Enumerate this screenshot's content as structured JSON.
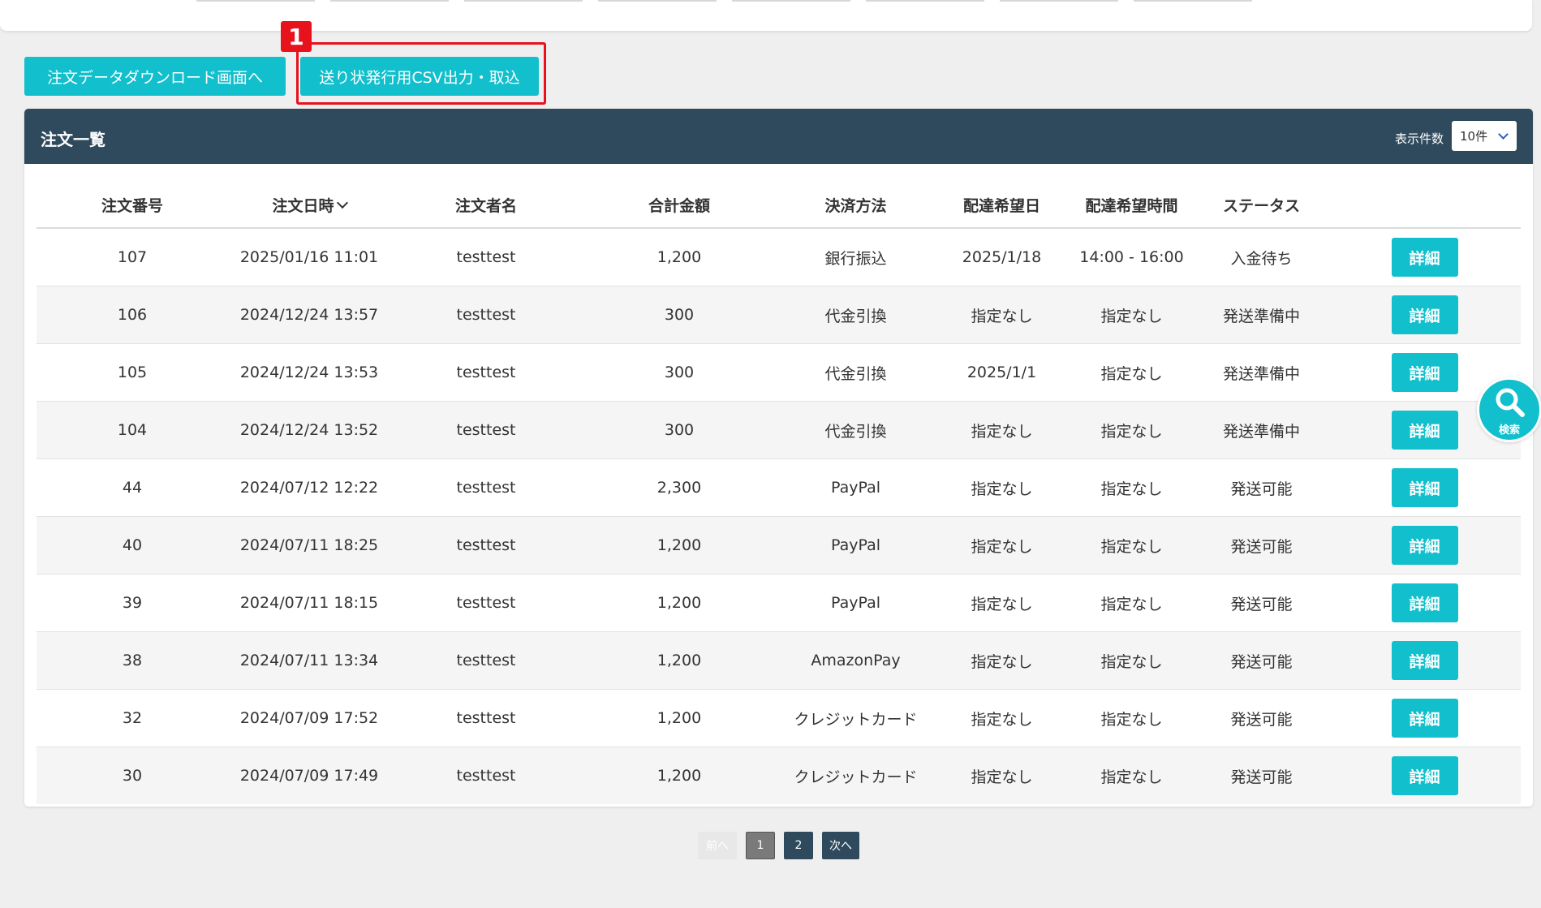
{
  "actions": {
    "download_label": "注文データダウンロード画面へ",
    "csv_label": "送り状発行用CSV出力・取込",
    "highlight_badge": "1"
  },
  "orders": {
    "title": "注文一覧",
    "per_page_label": "表示件数",
    "per_page_value": "10件",
    "columns": [
      "注文番号",
      "注文日時",
      "注文者名",
      "合計金額",
      "決済方法",
      "配達希望日",
      "配達希望時間",
      "ステータス"
    ],
    "detail_label": "詳細",
    "rows": [
      {
        "no": "107",
        "date": "2025/01/16 11:01",
        "name": "testtest",
        "total": "1,200",
        "payment": "銀行振込",
        "delivery_date": "2025/1/18",
        "delivery_time": "14:00 - 16:00",
        "status": "入金待ち"
      },
      {
        "no": "106",
        "date": "2024/12/24 13:57",
        "name": "testtest",
        "total": "300",
        "payment": "代金引換",
        "delivery_date": "指定なし",
        "delivery_time": "指定なし",
        "status": "発送準備中"
      },
      {
        "no": "105",
        "date": "2024/12/24 13:53",
        "name": "testtest",
        "total": "300",
        "payment": "代金引換",
        "delivery_date": "2025/1/1",
        "delivery_time": "指定なし",
        "status": "発送準備中"
      },
      {
        "no": "104",
        "date": "2024/12/24 13:52",
        "name": "testtest",
        "total": "300",
        "payment": "代金引換",
        "delivery_date": "指定なし",
        "delivery_time": "指定なし",
        "status": "発送準備中"
      },
      {
        "no": "44",
        "date": "2024/07/12 12:22",
        "name": "testtest",
        "total": "2,300",
        "payment": "PayPal",
        "delivery_date": "指定なし",
        "delivery_time": "指定なし",
        "status": "発送可能"
      },
      {
        "no": "40",
        "date": "2024/07/11 18:25",
        "name": "testtest",
        "total": "1,200",
        "payment": "PayPal",
        "delivery_date": "指定なし",
        "delivery_time": "指定なし",
        "status": "発送可能"
      },
      {
        "no": "39",
        "date": "2024/07/11 18:15",
        "name": "testtest",
        "total": "1,200",
        "payment": "PayPal",
        "delivery_date": "指定なし",
        "delivery_time": "指定なし",
        "status": "発送可能"
      },
      {
        "no": "38",
        "date": "2024/07/11 13:34",
        "name": "testtest",
        "total": "1,200",
        "payment": "AmazonPay",
        "delivery_date": "指定なし",
        "delivery_time": "指定なし",
        "status": "発送可能"
      },
      {
        "no": "32",
        "date": "2024/07/09 17:52",
        "name": "testtest",
        "total": "1,200",
        "payment": "クレジットカード",
        "delivery_date": "指定なし",
        "delivery_time": "指定なし",
        "status": "発送可能"
      },
      {
        "no": "30",
        "date": "2024/07/09 17:49",
        "name": "testtest",
        "total": "1,200",
        "payment": "クレジットカード",
        "delivery_date": "指定なし",
        "delivery_time": "指定なし",
        "status": "発送可能"
      }
    ]
  },
  "pagination": {
    "prev_label": "前へ",
    "pages": [
      "1",
      "2"
    ],
    "current_page": "1",
    "next_label": "次へ"
  },
  "search_fab": {
    "label": "検索",
    "icon": "search-icon"
  },
  "colors": {
    "accent": "#12bfcc",
    "header": "#2f4a5d",
    "highlight": "#e8121d"
  }
}
